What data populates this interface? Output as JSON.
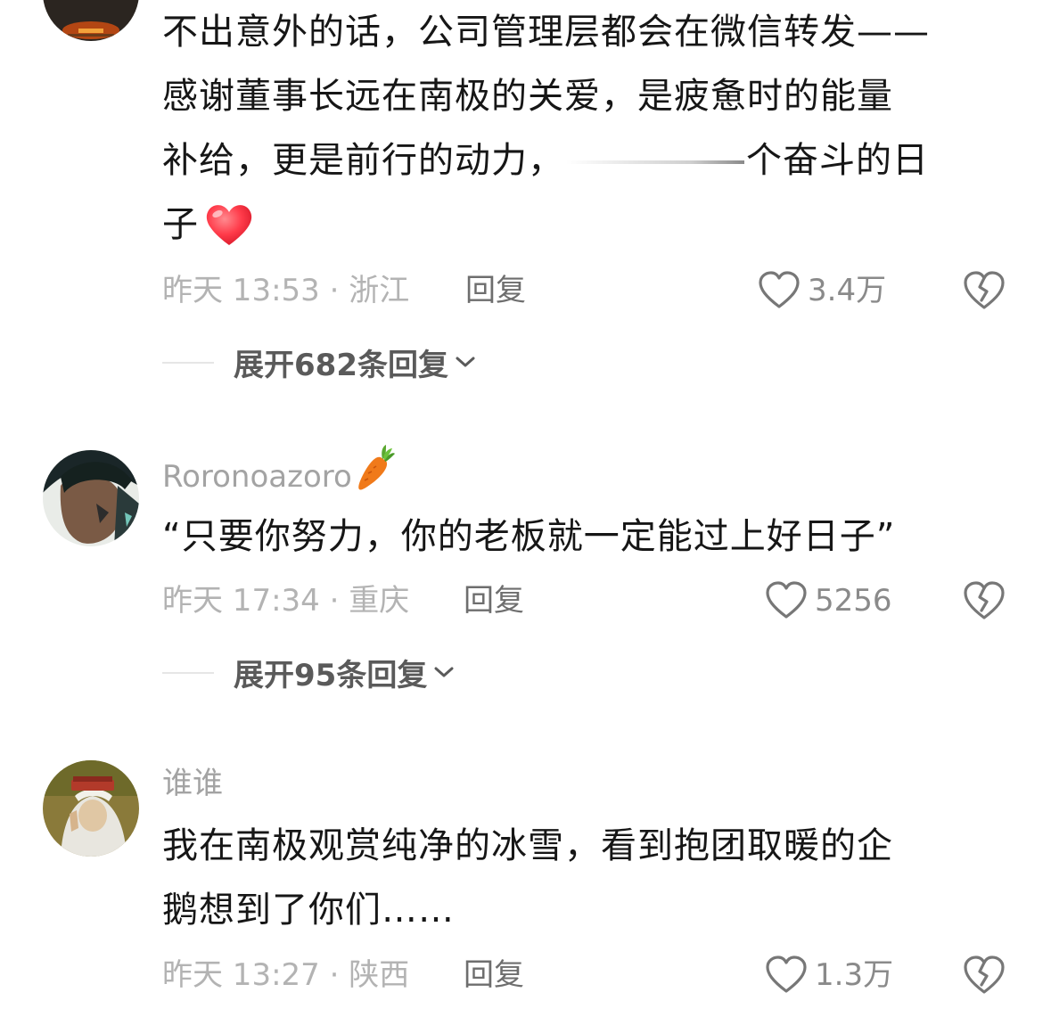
{
  "comments": [
    {
      "username": "",
      "text_lines": [
        "不出意外的话，公司管理层都会在微信转发——",
        "感谢董事长远在南极的关爱，是疲惫时的能量",
        "补给，更是前行的动力，",
        "个奋斗的日",
        "子"
      ],
      "emoji": "heart-emoji",
      "time_location": "昨天 13:53 · 浙江",
      "reply_label": "回复",
      "like_count": "3.4万",
      "expand_label": "展开682条回复"
    },
    {
      "username": "Roronoazoro",
      "username_emoji": "carrot-emoji",
      "text_lines": [
        "“只要你努力，你的老板就一定能过上好日子”"
      ],
      "time_location": "昨天 17:34 · 重庆",
      "reply_label": "回复",
      "like_count": "5256",
      "expand_label": "展开95条回复"
    },
    {
      "username": "谁谁",
      "text_lines": [
        "我在南极观赏纯净的冰雪，看到抱团取暖的企",
        "鹅想到了你们……"
      ],
      "time_location": "昨天 13:27 · 陕西",
      "reply_label": "回复",
      "like_count": "1.3万"
    }
  ],
  "colors": {
    "text_main": "#161616",
    "text_meta": "#b3b3b3",
    "username": "#a3a3a3",
    "reply": "#6e6e6e",
    "expand": "#5a5a5a",
    "heart_red": "#ff3b4a"
  }
}
